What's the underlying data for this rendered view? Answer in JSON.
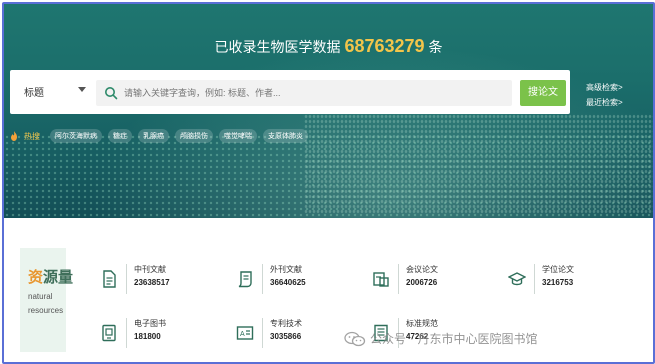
{
  "hero": {
    "headline_prefix": "已收录生物医学数据",
    "count": "68763279",
    "headline_suffix": "条"
  },
  "search": {
    "field_selected": "标题",
    "placeholder": "请输入关键字查询，例如: 标题、作者...",
    "button_label": "搜论文",
    "advanced_label": "高级检索>",
    "recent_label": "最近检索>"
  },
  "hot": {
    "label": "热搜",
    "items": [
      "阿尔茨海默病",
      "糖症",
      "乳腺癌",
      "颅脑损伤",
      "噬觉哮喘",
      "支原体肺炎"
    ]
  },
  "resources": {
    "title_first": "资",
    "title_rest": "源量",
    "sub_line1": "natural",
    "sub_line2": "resources",
    "items": [
      {
        "name": "中刊文献",
        "count": "23638517",
        "icon": "journal-doc-icon"
      },
      {
        "name": "外刊文献",
        "count": "36640625",
        "icon": "foreign-journal-icon"
      },
      {
        "name": "会议论文",
        "count": "2006726",
        "icon": "conference-icon"
      },
      {
        "name": "学位论文",
        "count": "3216753",
        "icon": "graduation-cap-icon"
      },
      {
        "name": "电子图书",
        "count": "181800",
        "icon": "ebook-icon"
      },
      {
        "name": "专利技术",
        "count": "3035866",
        "icon": "patent-icon"
      },
      {
        "name": "标准规范",
        "count": "47262",
        "icon": "standard-icon"
      }
    ]
  },
  "watermark": {
    "text": "公众号 · 丹东市中心医院图书馆"
  },
  "colors": {
    "hero_dark": "#175e62",
    "accent_count": "#f3c54a",
    "search_button": "#7bc24a",
    "frame": "#5a6fd6"
  }
}
